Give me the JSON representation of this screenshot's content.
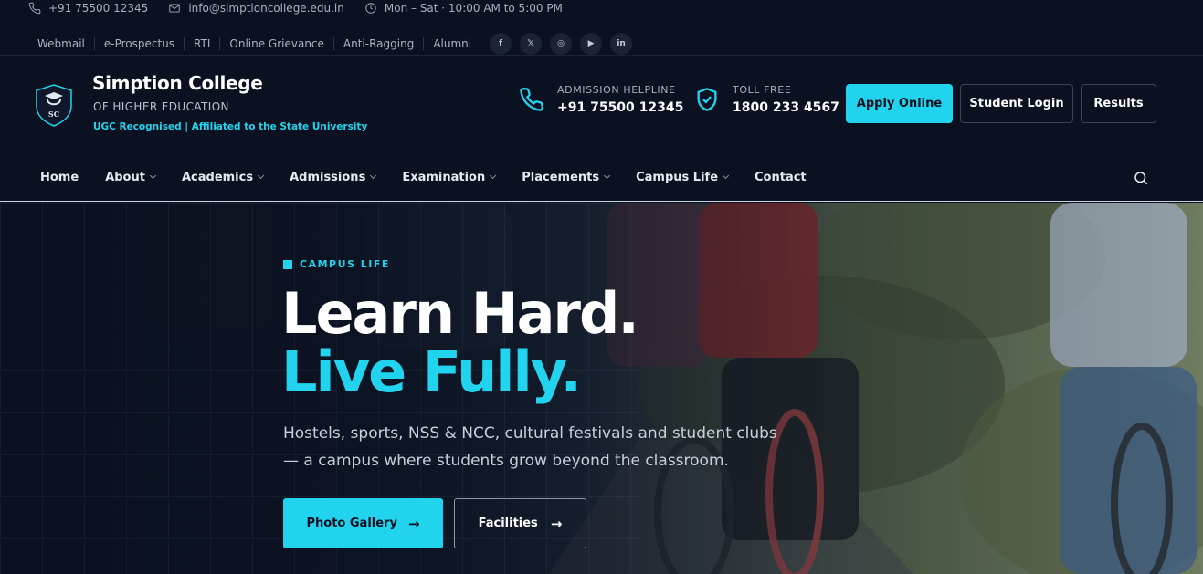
{
  "topbar": {
    "phone": "+91 75500 12345",
    "email": "info@simptioncollege.edu.in",
    "hours": "Mon – Sat · 10:00 AM to 5:00 PM",
    "quick_links": [
      "Webmail",
      "e-Prospectus",
      "RTI",
      "Online Grievance",
      "Anti-Ragging",
      "Alumni"
    ],
    "socials": [
      {
        "icon": "facebook-icon",
        "glyph": "f"
      },
      {
        "icon": "x-icon",
        "glyph": "𝕏"
      },
      {
        "icon": "instagram-icon",
        "glyph": "◎"
      },
      {
        "icon": "youtube-icon",
        "glyph": "▶"
      },
      {
        "icon": "linkedin-icon",
        "glyph": "in"
      }
    ]
  },
  "brand": {
    "logo_text": "SC",
    "name": "Simption College",
    "subtitle": "OF HIGHER EDUCATION",
    "tagline": "UGC Recognised | Affiliated to the State University"
  },
  "contacts": {
    "helpline_label": "ADMISSION HELPLINE",
    "helpline_value": "+91 75500 12345",
    "tollfree_label": "TOLL FREE",
    "tollfree_value": "1800 233 4567"
  },
  "header_buttons": {
    "apply": "Apply Online",
    "login": "Student Login",
    "results": "Results"
  },
  "nav": {
    "items": [
      {
        "label": "Home",
        "dropdown": false
      },
      {
        "label": "About",
        "dropdown": true
      },
      {
        "label": "Academics",
        "dropdown": true
      },
      {
        "label": "Admissions",
        "dropdown": true
      },
      {
        "label": "Examination",
        "dropdown": true
      },
      {
        "label": "Placements",
        "dropdown": true
      },
      {
        "label": "Campus Life",
        "dropdown": true
      },
      {
        "label": "Contact",
        "dropdown": false
      }
    ]
  },
  "hero": {
    "eyebrow": "CAMPUS LIFE",
    "headline_line1": "Learn Hard.",
    "headline_line2": "Live Fully.",
    "description": "Hostels, sports, NSS & NCC, cultural festivals and student clubs — a campus where students grow beyond the classroom.",
    "primary_button": "Photo Gallery",
    "secondary_button": "Facilities",
    "arrow": "→"
  },
  "colors": {
    "background": "#0b1120",
    "accent": "#22d3ee",
    "text": "#ffffff"
  }
}
